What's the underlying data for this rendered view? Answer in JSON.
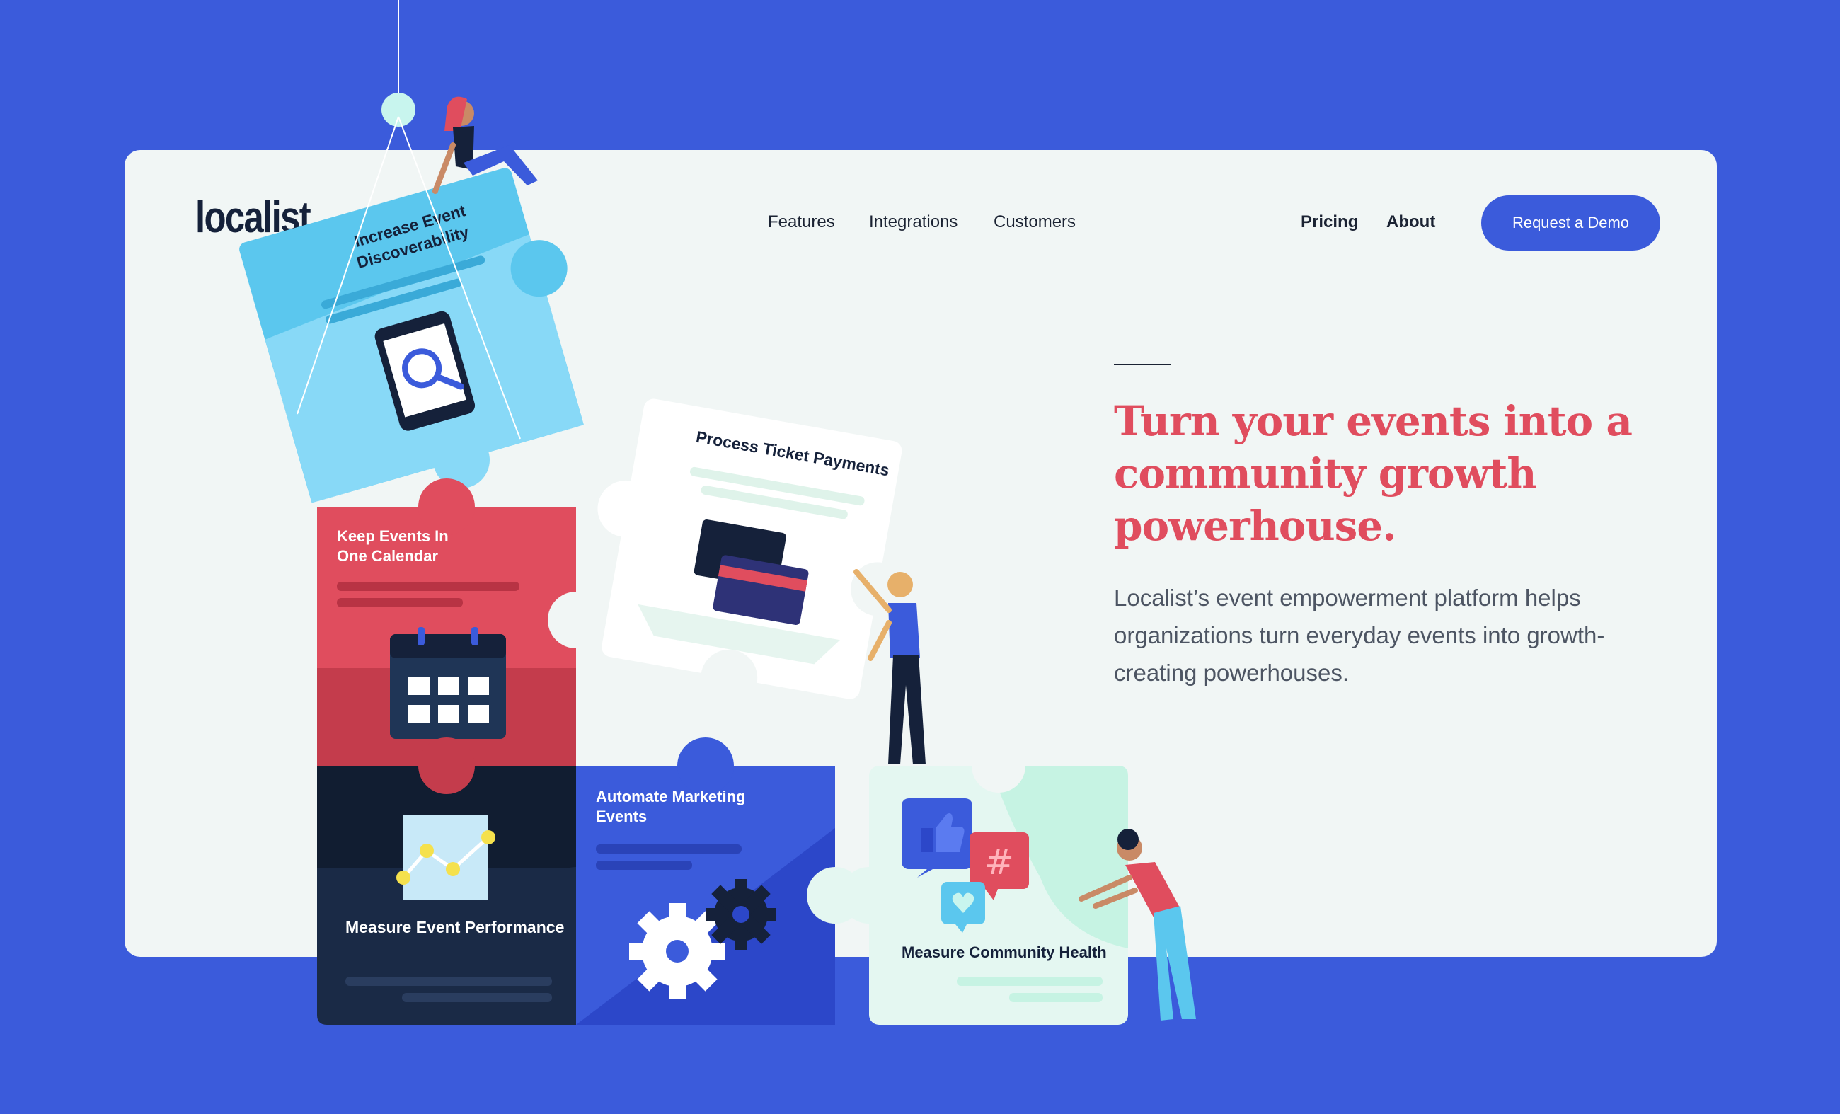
{
  "brand": {
    "logo_text": "localist"
  },
  "nav": {
    "features": "Features",
    "integrations": "Integrations",
    "customers": "Customers",
    "pricing": "Pricing",
    "about": "About",
    "cta": "Request a Demo"
  },
  "hero": {
    "headline": "Turn your events into a community growth powerhouse.",
    "lead": "Localist’s event empowerment platform helps organizations turn everyday events into growth-creating powerhouses."
  },
  "puzzle": {
    "discoverability_1": "Increase Event",
    "discoverability_2": "Discoverability",
    "ticket": "Process Ticket Payments",
    "calendar_1": "Keep Events In",
    "calendar_2": "One Calendar",
    "performance": "Measure Event Performance",
    "marketing_1": "Automate Marketing",
    "marketing_2": "Events",
    "community": "Measure Community Health"
  },
  "colors": {
    "background": "#3b5bdb",
    "card": "#f1f6f5",
    "accent_red": "#e04d5e",
    "navy": "#15213a",
    "sky": "#5bc7ee",
    "mint": "#d6f7ec"
  }
}
